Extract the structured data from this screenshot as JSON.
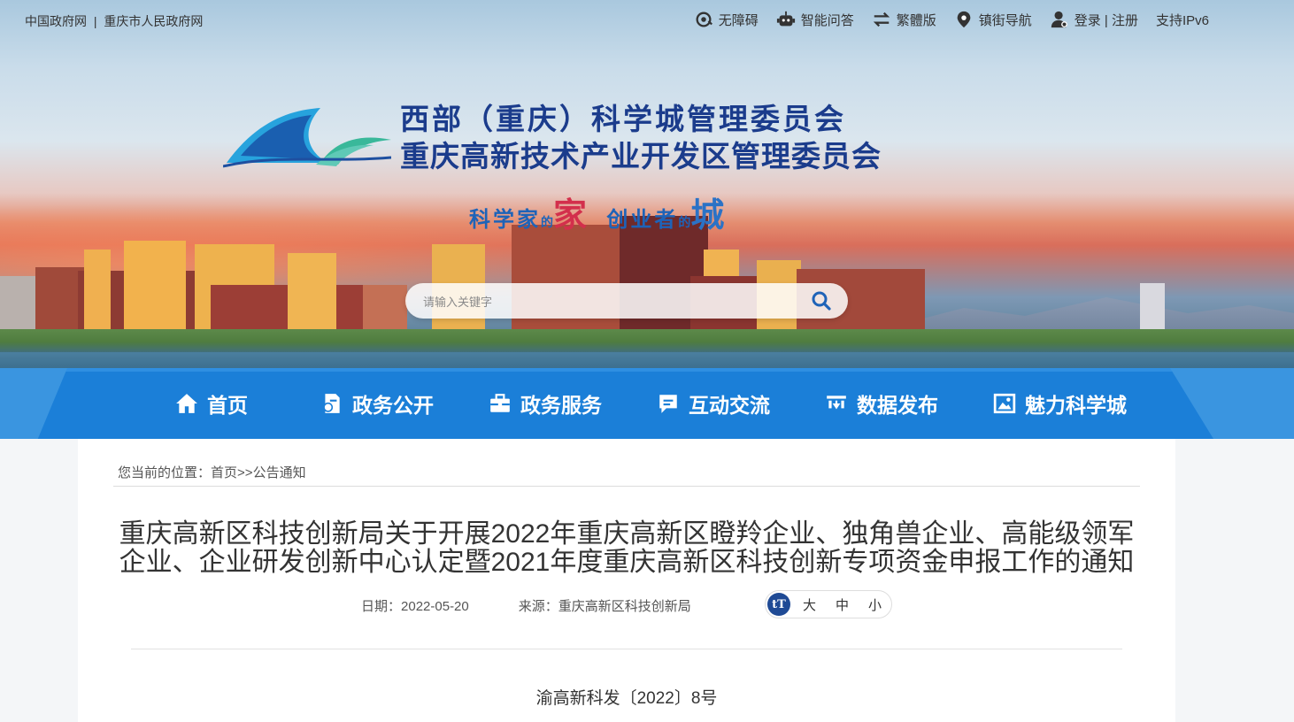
{
  "topbar": {
    "gov_link": "中国政府网",
    "divider": "|",
    "city_link": "重庆市人民政府网",
    "links": [
      {
        "label": "无障碍",
        "icon": "accessibility-icon"
      },
      {
        "label": "智能问答",
        "icon": "robot-icon"
      },
      {
        "label": "繁體版",
        "icon": "switch-icon"
      },
      {
        "label": "镇街导航",
        "icon": "location-icon"
      },
      {
        "label": "登录 | 注册",
        "icon": "user-icon"
      },
      {
        "label": "支持IPv6",
        "icon": ""
      }
    ]
  },
  "header": {
    "title_line1": "西部（重庆）科学城管理委员会",
    "title_line2": "重庆高新技术产业开发区管理委员会",
    "slogan": {
      "part1": "科学家",
      "of1": "的",
      "home": "家",
      "part2": "创业者",
      "of2": "的",
      "city": "城"
    }
  },
  "search": {
    "placeholder": "请输入关键字"
  },
  "nav": [
    {
      "label": "首页",
      "icon": "home-icon"
    },
    {
      "label": "政务公开",
      "icon": "document-icon"
    },
    {
      "label": "政务服务",
      "icon": "briefcase-icon"
    },
    {
      "label": "互动交流",
      "icon": "chat-icon"
    },
    {
      "label": "数据发布",
      "icon": "data-icon"
    },
    {
      "label": "魅力科学城",
      "icon": "picture-icon"
    }
  ],
  "breadcrumb": {
    "prefix": "您当前的位置：",
    "home": "首页",
    "sep": ">>",
    "current": "公告通知"
  },
  "article": {
    "title_line1": "重庆高新区科技创新局关于开展2022年重庆高新区瞪羚企业、独角兽企业、高能级领军",
    "title_line2": "企业、企业研发创新中心认定暨2021年度重庆高新区科技创新专项资金申报工作的通知",
    "date_label": "日期：",
    "date": "2022-05-20",
    "source_label": "来源：",
    "source": "重庆高新区科技创新局",
    "font_size": {
      "icon_text": "tT",
      "large": "大",
      "medium": "中",
      "small": "小"
    },
    "doc_number": "渝高新科发〔2022〕8号"
  },
  "colors": {
    "nav_bg": "#1b7fd8",
    "title_blue": "#1b3c8c",
    "slogan_red": "#d32f4c"
  }
}
